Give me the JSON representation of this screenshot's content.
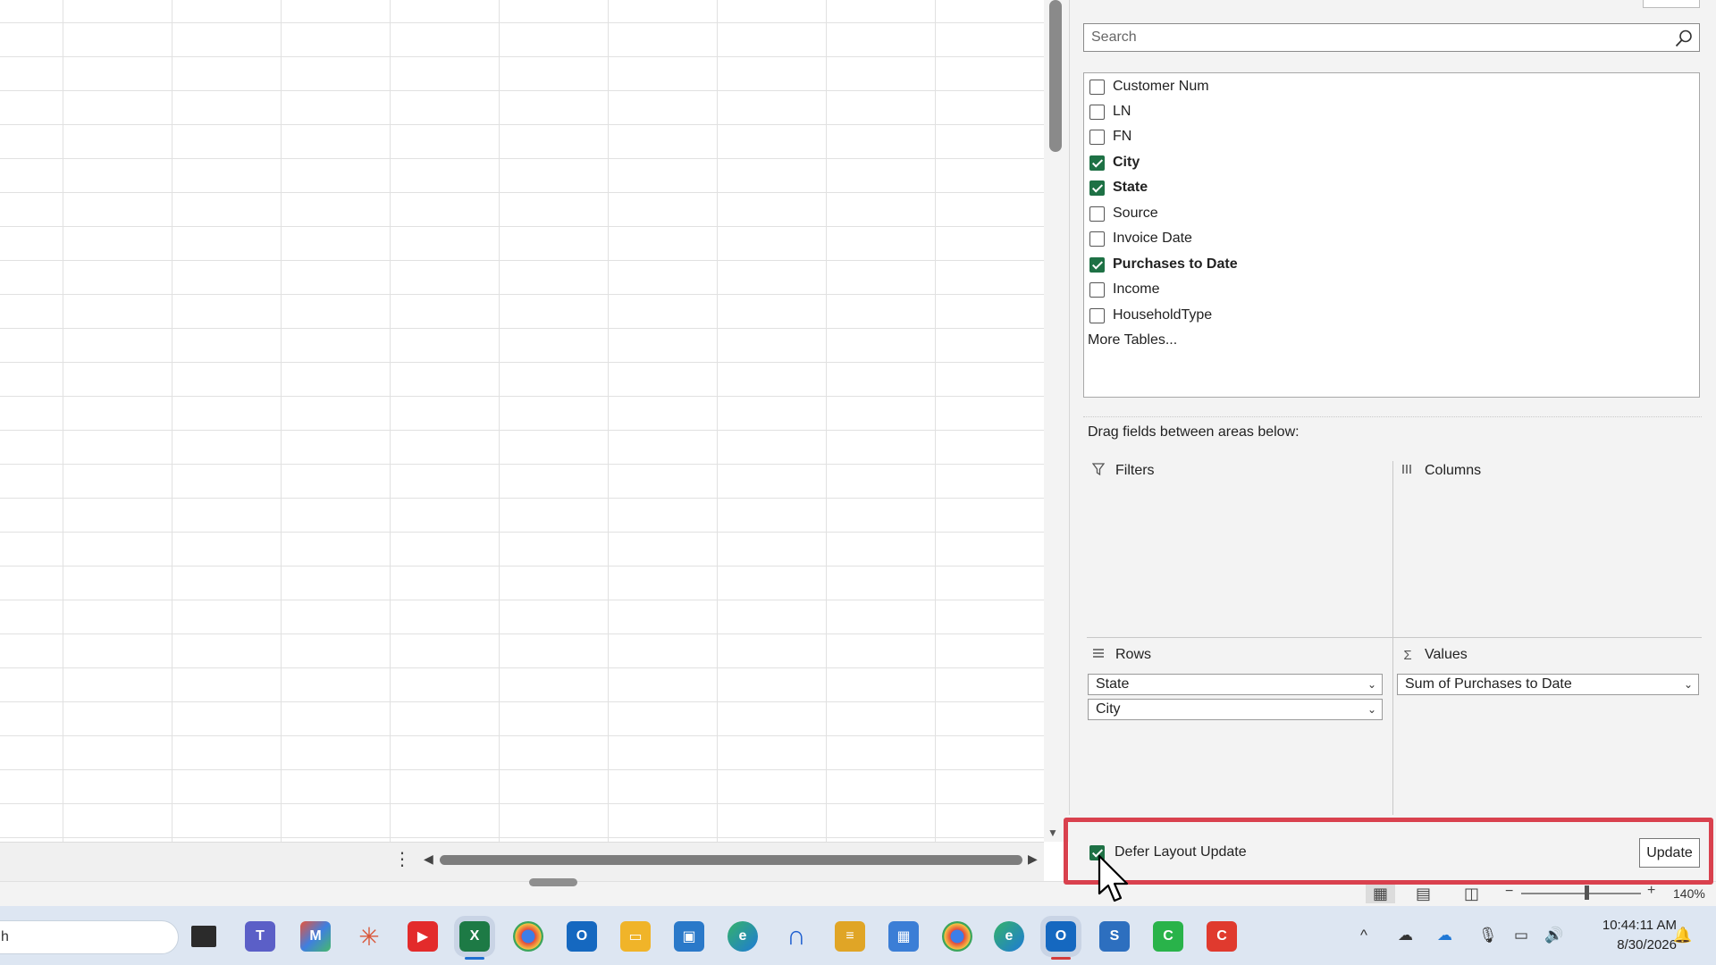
{
  "search": {
    "placeholder": "Search"
  },
  "fields": [
    {
      "label": "Customer Num",
      "checked": false
    },
    {
      "label": "LN",
      "checked": false
    },
    {
      "label": "FN",
      "checked": false
    },
    {
      "label": "City",
      "checked": true
    },
    {
      "label": "State",
      "checked": true
    },
    {
      "label": "Source",
      "checked": false
    },
    {
      "label": "Invoice Date",
      "checked": false
    },
    {
      "label": "Purchases to Date",
      "checked": true
    },
    {
      "label": "Income",
      "checked": false
    },
    {
      "label": "HouseholdType",
      "checked": false
    }
  ],
  "more_tables": "More Tables...",
  "drag_hint": "Drag fields between areas below:",
  "areas": {
    "filters": {
      "label": "Filters",
      "icon": "filter-icon"
    },
    "columns": {
      "label": "Columns",
      "icon": "columns-icon"
    },
    "rows": {
      "label": "Rows",
      "icon": "rows-icon",
      "items": [
        "State",
        "City"
      ]
    },
    "values": {
      "label": "Values",
      "icon": "sigma-icon",
      "items": [
        "Sum of Purchases to Date"
      ]
    }
  },
  "defer": {
    "label": "Defer Layout Update",
    "checked": true,
    "button": "Update"
  },
  "status": {
    "zoom": "140%"
  },
  "taskbar": {
    "search_text": "h",
    "clock_time": "10:44:11 AM",
    "clock_date": "8/30/2026"
  },
  "colors": {
    "accent": "#1e7145",
    "highlight": "#d9414e",
    "taskbar": "#dde6f2"
  }
}
